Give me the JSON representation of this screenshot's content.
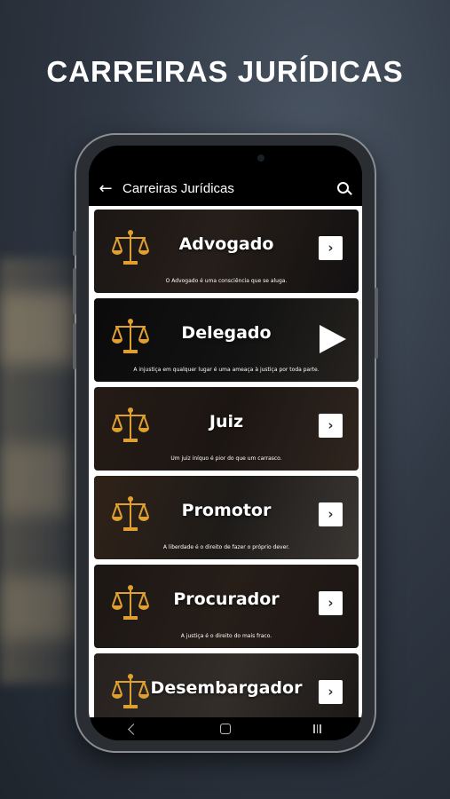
{
  "promo": {
    "title": "CARREIRAS JURÍDICAS"
  },
  "appbar": {
    "title": "Carreiras Jurídicas",
    "back_icon": "arrow-left-icon",
    "search_icon": "search-icon"
  },
  "careers": [
    {
      "title": "Advogado",
      "quote": "O Advogado é uma consciência que se aluga.",
      "action_icon": "chevron-right-icon"
    },
    {
      "title": "Delegado",
      "quote": "A injustiça em qualquer lugar é uma ameaça à justiça por toda parte.",
      "action_icon": "play-arrow-icon"
    },
    {
      "title": "Juiz",
      "quote": "Um juiz iníquo é pior do que um carrasco.",
      "action_icon": "chevron-right-icon"
    },
    {
      "title": "Promotor",
      "quote": "A liberdade é o direito de fazer o próprio dever.",
      "action_icon": "chevron-right-icon"
    },
    {
      "title": "Procurador",
      "quote": "A justiça é o direito do mais fraco.",
      "action_icon": "chevron-right-icon"
    },
    {
      "title": "Desembargador",
      "quote": "",
      "action_icon": "chevron-right-icon"
    }
  ],
  "colors": {
    "accent": "#E0A030",
    "background": "#303844"
  }
}
